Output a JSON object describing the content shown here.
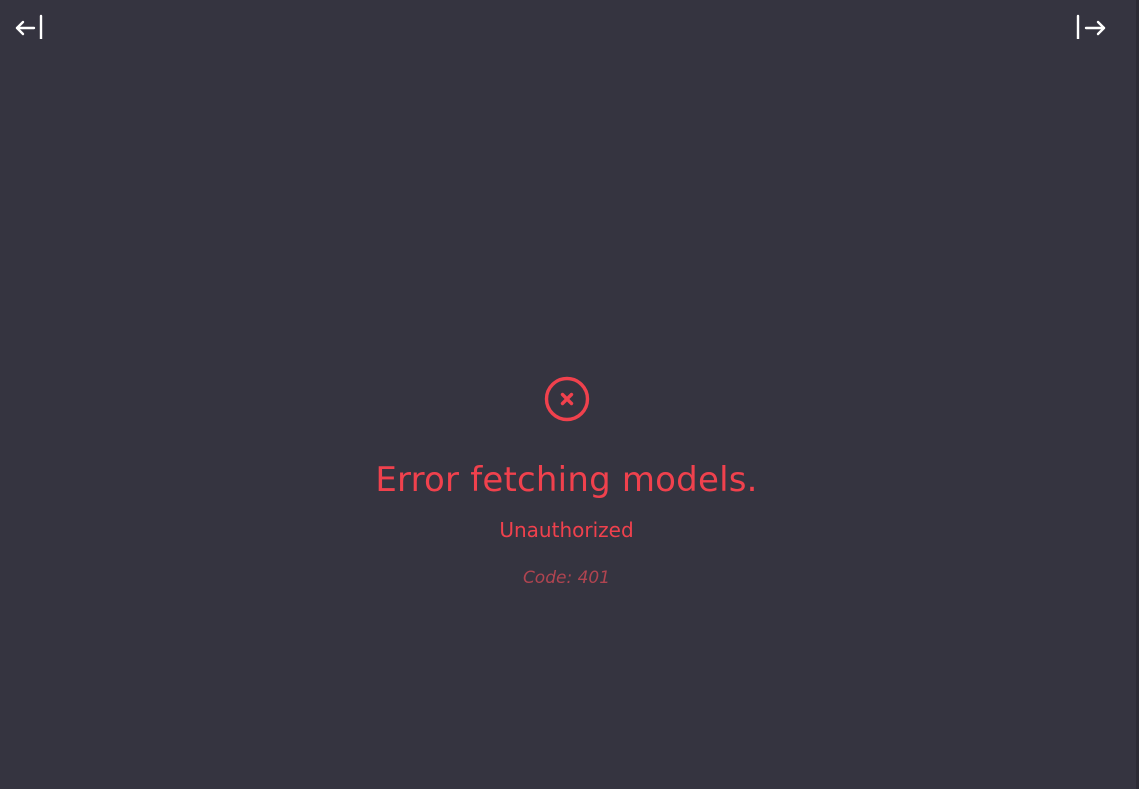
{
  "sidebar_toggles": {
    "left_icon": "collapse-left-icon",
    "right_icon": "expand-right-icon"
  },
  "error": {
    "icon": "circle-x-icon",
    "title": "Error fetching models.",
    "message": "Unauthorized",
    "code_label": "Code:",
    "code_value": "401"
  },
  "colors": {
    "background": "#353440",
    "error": "#f0414d",
    "muted_error": "#b04450",
    "icon": "#ffffff"
  }
}
